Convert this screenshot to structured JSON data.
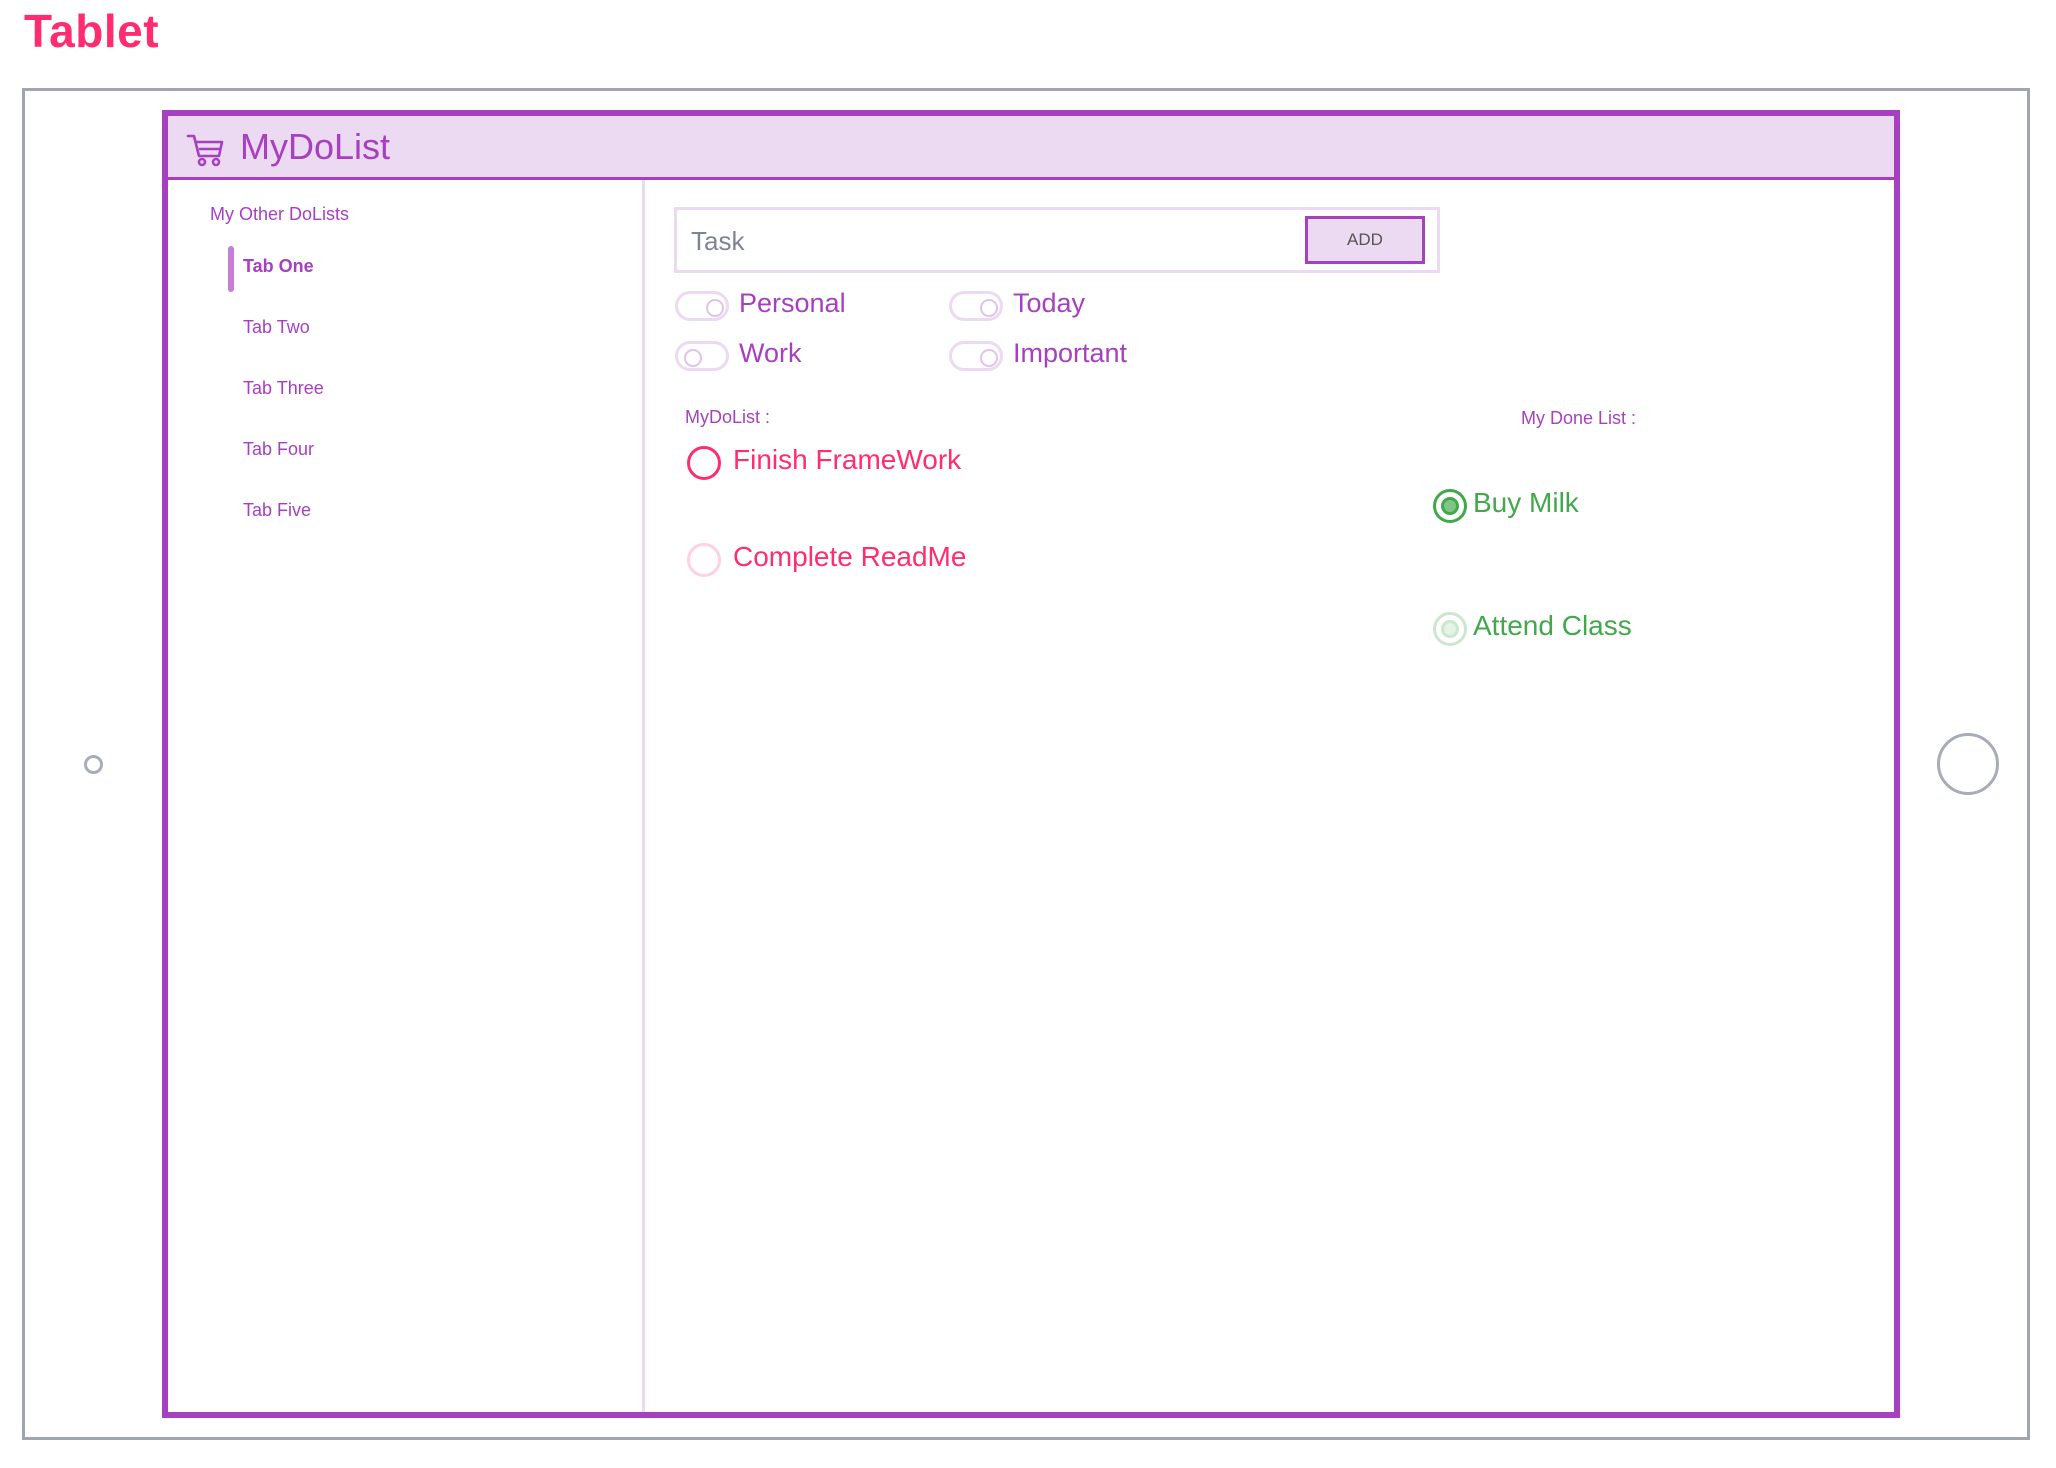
{
  "device": {
    "title": "Tablet"
  },
  "app": {
    "title": "MyDoList"
  },
  "sidebar": {
    "heading": "My Other DoLists",
    "tabs": [
      {
        "label": "Tab One",
        "active": true
      },
      {
        "label": "Tab Two",
        "active": false
      },
      {
        "label": "Tab Three",
        "active": false
      },
      {
        "label": "Tab Four",
        "active": false
      },
      {
        "label": "Tab Five",
        "active": false
      }
    ]
  },
  "task": {
    "placeholder": "Task",
    "value": "",
    "add_label": "ADD"
  },
  "toggles": [
    {
      "label": "Personal",
      "on": true
    },
    {
      "label": "Today",
      "on": true
    },
    {
      "label": "Work",
      "on": false
    },
    {
      "label": "Important",
      "on": true
    }
  ],
  "todo": {
    "heading": "MyDoList :",
    "items": [
      {
        "label": "Finish FrameWork",
        "checked": false
      },
      {
        "label": "Complete ReadMe",
        "checked": false
      }
    ]
  },
  "done": {
    "heading": "My Done List :",
    "items": [
      {
        "label": "Buy Milk",
        "checked": true
      },
      {
        "label": "Attend Class",
        "checked": true
      }
    ]
  },
  "colors": {
    "accent": "#a740c0",
    "accent_light": "#ecd9f2",
    "todo": "#ff2d6f",
    "done": "#42a84b",
    "device_frame": "#a0a6b0"
  },
  "icons": {
    "app_logo": "shopping-cart-icon"
  }
}
